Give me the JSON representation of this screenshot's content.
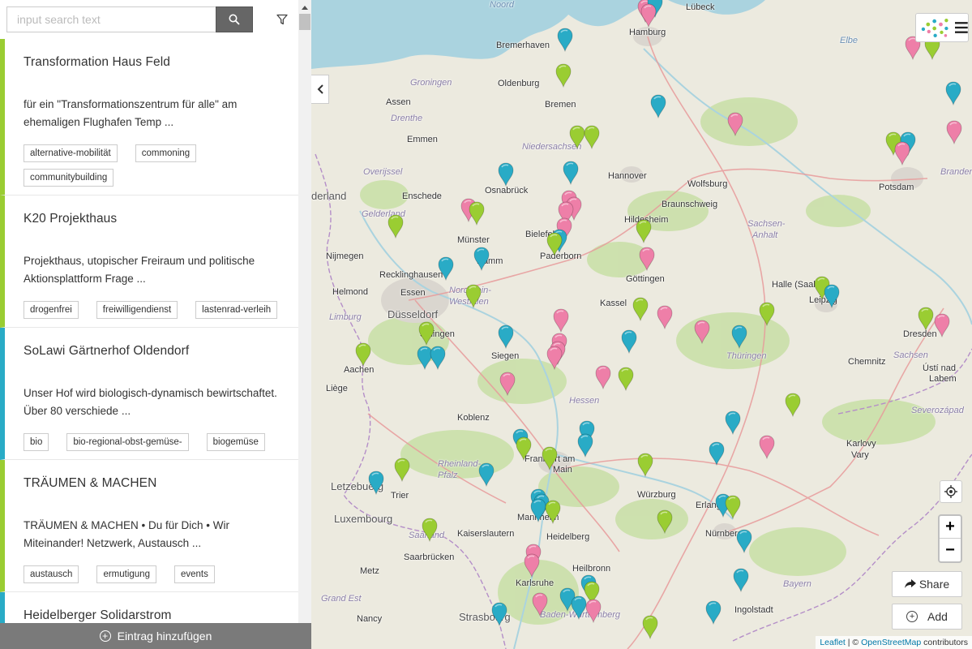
{
  "search": {
    "placeholder": "input search text"
  },
  "entries": [
    {
      "title": "Transformation Haus Feld",
      "description": "für ein \"Transformationszentrum für alle\" am ehemaligen Flughafen Temp ...",
      "color": "#9acd32",
      "tags": [
        "alternative-mobilität",
        "commoning",
        "communitybuilding"
      ]
    },
    {
      "title": "K20 Projekthaus",
      "description": "Projekthaus, utopischer Freiraum und politische Aktionsplattform Frage ...",
      "color": "#9acd32",
      "tags": [
        "drogenfrei",
        "freiwilligendienst",
        "lastenrad-verleih"
      ]
    },
    {
      "title": "SoLawi Gärtnerhof Oldendorf",
      "description": "Unser Hof wird biologisch-dynamisch bewirtschaftet. Über 80 verschiede ...",
      "color": "#29abc6",
      "tags": [
        "bio",
        "bio-regional-obst-gemüse-",
        "biogemüse"
      ]
    },
    {
      "title": "TRÄUMEN & MACHEN",
      "description": "TRÄUMEN & MACHEN • Du für Dich • Wir Miteinander! Netzwerk, Austausch ...",
      "color": "#9acd32",
      "tags": [
        "austausch",
        "ermutigung",
        "events"
      ]
    },
    {
      "title": "Heidelberger Solidarstrom",
      "description": "",
      "color": "#29abc6",
      "tags": []
    }
  ],
  "add_entry_label": "Eintrag hinzufügen",
  "map": {
    "share_label": "Share",
    "add_label": "Add",
    "attribution_leaflet": "Leaflet",
    "attribution_sep": " | © ",
    "attribution_osm": "OpenStreetMap",
    "attribution_suffix": " contributors",
    "labels": [
      {
        "text": "Lübeck",
        "cls": "",
        "key": "luebeck"
      },
      {
        "text": "Hamburg",
        "cls": "",
        "key": "hamburg"
      },
      {
        "text": "Bremerhaven",
        "cls": "",
        "key": "bremerhaven"
      },
      {
        "text": "Oldenburg",
        "cls": "",
        "key": "oldenburg"
      },
      {
        "text": "Bremen",
        "cls": "",
        "key": "bremen"
      },
      {
        "text": "Groningen",
        "cls": "region",
        "key": "groningen"
      },
      {
        "text": "Assen",
        "cls": "",
        "key": "assen"
      },
      {
        "text": "Drenthe",
        "cls": "region",
        "key": "drenthe"
      },
      {
        "text": "Emmen",
        "cls": "",
        "key": "emmen"
      },
      {
        "text": "Niedersachsen",
        "cls": "region",
        "key": "niedersachsen"
      },
      {
        "text": "Overijssel",
        "cls": "region",
        "key": "overijssel"
      },
      {
        "text": "Hannover",
        "cls": "",
        "key": "hannover"
      },
      {
        "text": "Wolfsburg",
        "cls": "",
        "key": "wolfsburg"
      },
      {
        "text": "Potsdam",
        "cls": "",
        "key": "potsdam"
      },
      {
        "text": "Brandenbu",
        "cls": "region",
        "key": "brandenburg"
      },
      {
        "text": "Osnabrück",
        "cls": "",
        "key": "osnabrueck"
      },
      {
        "text": "Enschede",
        "cls": "",
        "key": "enschede"
      },
      {
        "text": "Braunschweig",
        "cls": "",
        "key": "braunschweig"
      },
      {
        "text": "derland",
        "cls": "big",
        "key": "nederland"
      },
      {
        "text": "Gelderland",
        "cls": "region",
        "key": "gelderland"
      },
      {
        "text": "Hildesheim",
        "cls": "",
        "key": "hildesheim"
      },
      {
        "text": "Bielefeld",
        "cls": "",
        "key": "bielefeld"
      },
      {
        "text": "Münster",
        "cls": "",
        "key": "muenster"
      },
      {
        "text": "Sachsen-",
        "cls": "region",
        "key": "sachsenanhalt1"
      },
      {
        "text": "Anhalt",
        "cls": "region",
        "key": "sachsenanhalt2"
      },
      {
        "text": "Nijmegen",
        "cls": "",
        "key": "nijmegen"
      },
      {
        "text": "Hamm",
        "cls": "",
        "key": "hamm"
      },
      {
        "text": "Paderborn",
        "cls": "",
        "key": "paderborn"
      },
      {
        "text": "Recklinghausen",
        "cls": "",
        "key": "recklinghausen"
      },
      {
        "text": "Göttingen",
        "cls": "",
        "key": "goettingen"
      },
      {
        "text": "Halle (Saale)",
        "cls": "",
        "key": "halle"
      },
      {
        "text": "Helmond",
        "cls": "",
        "key": "helmond"
      },
      {
        "text": "Essen",
        "cls": "",
        "key": "essen"
      },
      {
        "text": "Nordrhein-",
        "cls": "region",
        "key": "nrw1"
      },
      {
        "text": "Westfalen",
        "cls": "region",
        "key": "nrw2"
      },
      {
        "text": "Kassel",
        "cls": "",
        "key": "kassel"
      },
      {
        "text": "Leipzig",
        "cls": "",
        "key": "leipzig"
      },
      {
        "text": "Düsseldorf",
        "cls": "big",
        "key": "duesseldorf"
      },
      {
        "text": "Limburg",
        "cls": "region",
        "key": "limburg"
      },
      {
        "text": "Solingen",
        "cls": "",
        "key": "solingen"
      },
      {
        "text": "Dresden",
        "cls": "",
        "key": "dresden"
      },
      {
        "text": "Siegen",
        "cls": "",
        "key": "siegen"
      },
      {
        "text": "Thüringen",
        "cls": "region",
        "key": "thueringen"
      },
      {
        "text": "Chemnitz",
        "cls": "",
        "key": "chemnitz"
      },
      {
        "text": "Sachsen",
        "cls": "region",
        "key": "sachsen"
      },
      {
        "text": "Aachen",
        "cls": "",
        "key": "aachen"
      },
      {
        "text": "Ústí nad",
        "cls": "",
        "key": "usti1"
      },
      {
        "text": "Labem",
        "cls": "",
        "key": "usti2"
      },
      {
        "text": "Liège",
        "cls": "",
        "key": "liege"
      },
      {
        "text": "Hessen",
        "cls": "region",
        "key": "hessen"
      },
      {
        "text": "Koblenz",
        "cls": "",
        "key": "koblenz"
      },
      {
        "text": "Severozápad",
        "cls": "region",
        "key": "severozapad"
      },
      {
        "text": "Karlovy",
        "cls": "",
        "key": "karlovy1"
      },
      {
        "text": "Vary",
        "cls": "",
        "key": "karlovy2"
      },
      {
        "text": "Frankfurt am",
        "cls": "",
        "key": "frankfurt1"
      },
      {
        "text": "Main",
        "cls": "",
        "key": "frankfurt2"
      },
      {
        "text": "Rheinland-",
        "cls": "region",
        "key": "rlp1"
      },
      {
        "text": "Pfalz",
        "cls": "region",
        "key": "rlp2"
      },
      {
        "text": "Letzebuerg",
        "cls": "big",
        "key": "letzebuerg"
      },
      {
        "text": "Trier",
        "cls": "",
        "key": "trier"
      },
      {
        "text": "Würzburg",
        "cls": "",
        "key": "wuerzburg"
      },
      {
        "text": "Erlangen",
        "cls": "",
        "key": "erlangen"
      },
      {
        "text": "Luxembourg",
        "cls": "big",
        "key": "luxembourg"
      },
      {
        "text": "Mannheim",
        "cls": "",
        "key": "mannheim"
      },
      {
        "text": "Kaiserslautern",
        "cls": "",
        "key": "kaiserslautern"
      },
      {
        "text": "Heidelberg",
        "cls": "",
        "key": "heidelberg"
      },
      {
        "text": "Nürnberg",
        "cls": "",
        "key": "nuernberg"
      },
      {
        "text": "Saarland",
        "cls": "region",
        "key": "saarland"
      },
      {
        "text": "Saarbrücken",
        "cls": "",
        "key": "saarbruecken"
      },
      {
        "text": "Metz",
        "cls": "",
        "key": "metz"
      },
      {
        "text": "Heilbronn",
        "cls": "",
        "key": "heilbronn"
      },
      {
        "text": "Bayern",
        "cls": "region",
        "key": "bayern"
      },
      {
        "text": "Karlsruhe",
        "cls": "",
        "key": "karlsruhe"
      },
      {
        "text": "Grand Est",
        "cls": "region",
        "key": "grandest"
      },
      {
        "text": "Ingolstadt",
        "cls": "",
        "key": "ingolstadt"
      },
      {
        "text": "Nancy",
        "cls": "",
        "key": "nancy"
      },
      {
        "text": "Strasbourg",
        "cls": "big",
        "key": "strasbourg"
      },
      {
        "text": "Baden-Württemberg",
        "cls": "region",
        "key": "bw"
      },
      {
        "text": "Noord",
        "cls": "water",
        "key": "noordzee"
      },
      {
        "text": "Elbe",
        "cls": "water",
        "key": "elbe"
      }
    ],
    "markers": [
      {
        "color": "green",
        "label": "marker-1"
      },
      {
        "color": "pink",
        "label": "marker-2"
      },
      {
        "color": "blue",
        "label": "marker-3"
      }
    ]
  },
  "colors": {
    "green": "#9acd32",
    "blue": "#29abc6",
    "pink": "#ee7fa8",
    "footer": "#7a7a7a"
  }
}
